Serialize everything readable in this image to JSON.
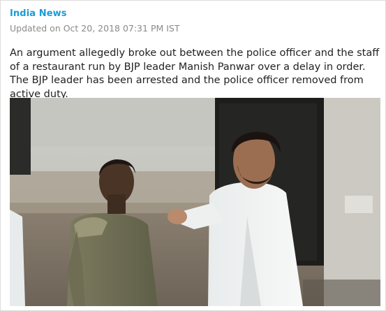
{
  "post": {
    "category": "India News",
    "updated": "Updated on Oct 20, 2018 07:31 PM IST",
    "summary": "An argument allegedly broke out between the police officer and the staff of a restaurant run by BJP leader Manish Panwar over a delay in order. The BJP leader has been arrested and the police officer removed from active duty."
  },
  "colors": {
    "category": "#1b9bd6",
    "meta": "#8a8a8a",
    "body_text": "#222222"
  }
}
